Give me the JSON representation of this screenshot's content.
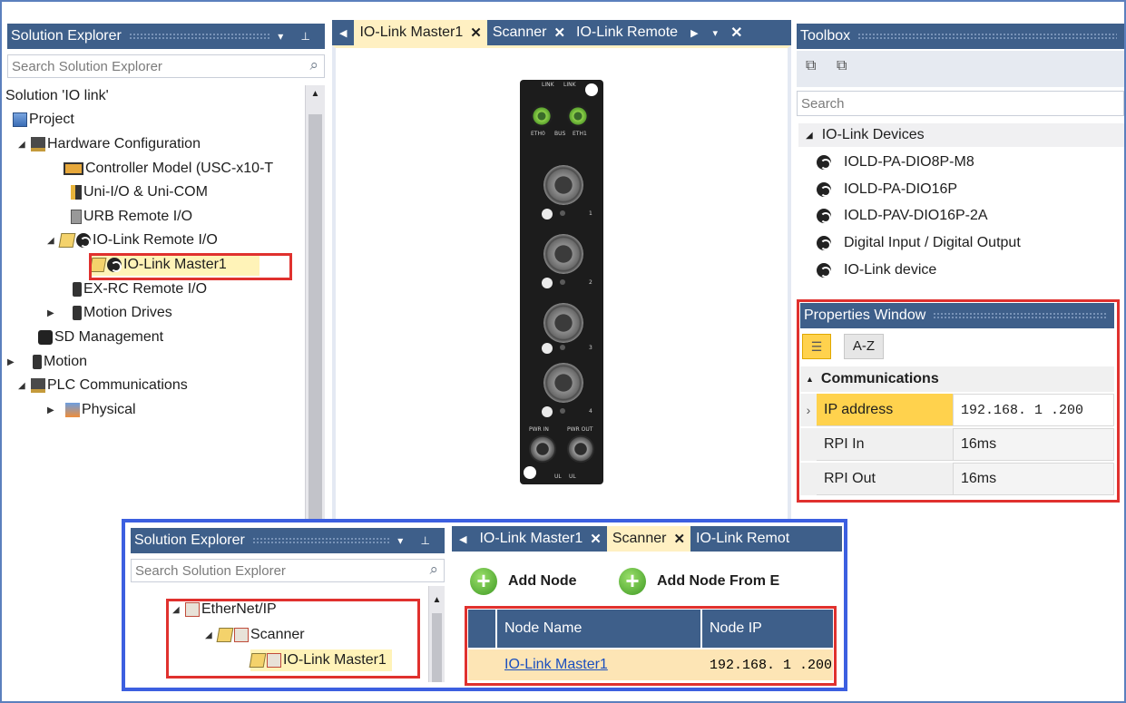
{
  "solution_explorer": {
    "title": "Solution Explorer",
    "search_placeholder": "Search Solution Explorer",
    "tree": [
      {
        "label": "Solution 'IO link'"
      },
      {
        "label": "Project"
      },
      {
        "label": "Hardware Configuration"
      },
      {
        "label": "Controller Model (USC-x10-T"
      },
      {
        "label": "Uni-I/O & Uni-COM"
      },
      {
        "label": "URB Remote I/O"
      },
      {
        "label": "IO-Link Remote I/O"
      },
      {
        "label": "IO-Link Master1"
      },
      {
        "label": "EX-RC Remote I/O"
      },
      {
        "label": "Motion Drives"
      },
      {
        "label": "SD Management"
      },
      {
        "label": "Motion"
      },
      {
        "label": "PLC Communications"
      },
      {
        "label": "Physical"
      }
    ]
  },
  "doc_tabs": [
    {
      "label": "IO-Link Master1",
      "active": true
    },
    {
      "label": "Scanner",
      "active": false
    },
    {
      "label": "IO-Link Remote",
      "active": false
    }
  ],
  "device": {
    "labels": {
      "link1": "LINK",
      "link2": "LINK",
      "eth0": "ETH0",
      "bus": "BUS",
      "eth1": "ETH1",
      "port1": "1",
      "port2": "2",
      "port3": "3",
      "port4": "4",
      "pwr_in": "PWR IN",
      "pwr_out": "PWR OUT",
      "ul1": "UL",
      "ul2": "UL"
    }
  },
  "toolbox": {
    "title": "Toolbox",
    "search_placeholder": "Search",
    "group": "IO-Link Devices",
    "items": [
      {
        "label": "IOLD-PA-DIO8P-M8"
      },
      {
        "label": "IOLD-PA-DIO16P"
      },
      {
        "label": "IOLD-PAV-DIO16P-2A"
      },
      {
        "label": "Digital Input / Digital Output"
      },
      {
        "label": "IO-Link device"
      }
    ]
  },
  "properties": {
    "title": "Properties Window",
    "sort_az": "A-Z",
    "category": "Communications",
    "rows": [
      {
        "name": "IP address",
        "value": "192.168.  1  .200"
      },
      {
        "name": "RPI In",
        "value": "16ms"
      },
      {
        "name": "RPI Out",
        "value": "16ms"
      }
    ]
  },
  "inset": {
    "se_title": "Solution Explorer",
    "se_search": "Search Solution Explorer",
    "tree": [
      {
        "label": "EtherNet/IP"
      },
      {
        "label": "Scanner"
      },
      {
        "label": "IO-Link Master1"
      }
    ],
    "tabs": [
      {
        "label": "IO-Link Master1",
        "active": false
      },
      {
        "label": "Scanner",
        "active": true
      },
      {
        "label": "IO-Link Remot",
        "active": false
      }
    ],
    "add_node": "Add Node",
    "add_node_from": "Add Node From E",
    "grid_headers": [
      "Node Name",
      "Node IP"
    ],
    "grid_rows": [
      {
        "name": "IO-Link Master1",
        "ip": "192.168.  1  .200"
      }
    ]
  },
  "colors": {
    "panel_header": "#3e5f8a",
    "active_tab": "#fff0c2",
    "highlight": "#e0312e",
    "inset_border": "#3c5fe0",
    "selected_row": "#fde5b5"
  }
}
